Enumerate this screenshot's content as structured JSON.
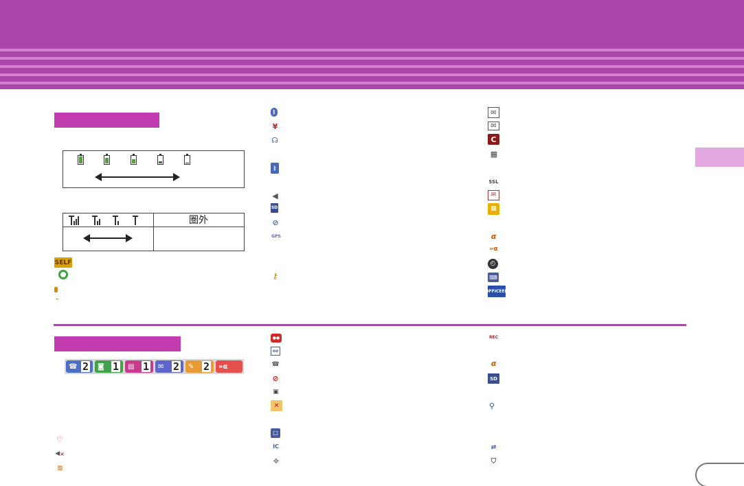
{
  "header": {
    "title": ""
  },
  "status_box": {
    "kengai_label": "圏外"
  },
  "side_tab": {
    "label": ""
  },
  "page_number": "",
  "icons": {
    "col1_top": [
      "self-mode-icon",
      "sync-icon",
      "small-orange-icon",
      "chevron-up-icon"
    ],
    "col2_top": [
      "bluetooth-icon",
      "yen-icon",
      "bluetooth-headset-icon",
      "bluetooth-transfer-icon",
      "speaker-icon",
      "sd-card-icon",
      "no-gps-icon",
      "gps-icon",
      "key-icon"
    ],
    "col3_top": [
      "mail-notify-icon",
      "mail-icon",
      "c-mail-icon",
      "sms-mail-icon",
      "ssl-off-icon",
      "mail-auto-icon",
      "calendar-icon",
      "i-channel-icon",
      "i-channel-receiving-icon",
      "clock-icon",
      "keyboard-icon",
      "office-ed-icon"
    ],
    "col1_bottom": [
      "heart-icon",
      "speaker-mute-icon",
      "vibrate-icon"
    ],
    "col2_bottom": [
      "car-icon",
      "drive-icon",
      "phone-lock-off-icon",
      "no-wireless-icon",
      "contact-off-icon",
      "grid-x-icon",
      "square-icon",
      "ic-off-icon",
      "dpad-icon"
    ],
    "col3_bottom": [
      "rec-icon",
      "i-channel-off-icon",
      "sd-icon",
      "usb-icon",
      "transfer-icon",
      "shield-x-icon"
    ]
  },
  "notifications": [
    {
      "icon": "missed-call-icon",
      "count": "2",
      "color": "#4a6fc8"
    },
    {
      "icon": "voicemail-icon",
      "count": "1",
      "color": "#3fa34a"
    },
    {
      "icon": "sms-icon",
      "count": "1",
      "color": "#c93a8c"
    },
    {
      "icon": "mail-icon",
      "count": "2",
      "color": "#5e66c9"
    },
    {
      "icon": "message-icon",
      "count": "2",
      "color": "#e89a35"
    },
    {
      "icon": "i-channel-icon",
      "count": "",
      "color": "#e5504f"
    }
  ],
  "colors": {
    "header": "#ab47ab",
    "stripe": "#d57fd2",
    "section_bar": "#c23cb0",
    "divider": "#a24ea5",
    "side_tab": "#e1a8e0"
  }
}
